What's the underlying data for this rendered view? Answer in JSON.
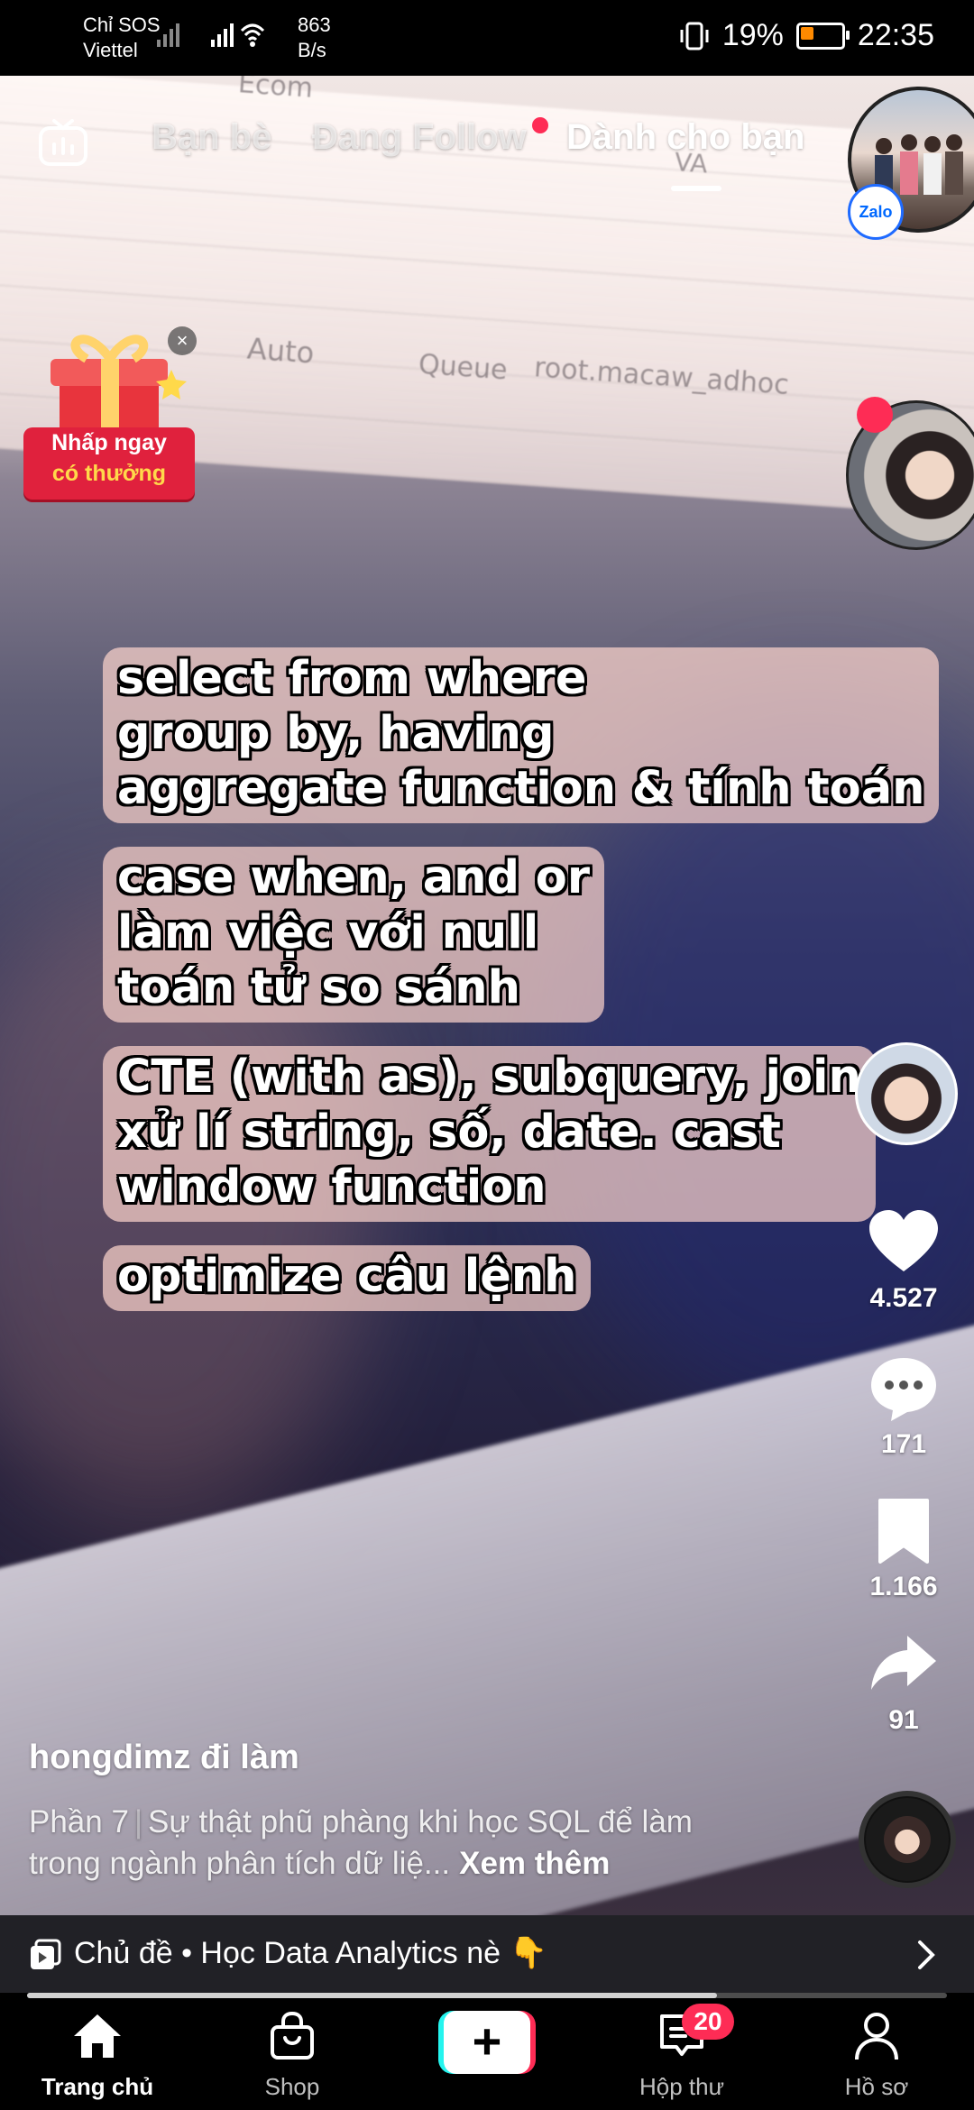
{
  "status_bar": {
    "carrier_line1": "Chỉ SOS",
    "carrier_line2": "Viettel",
    "net_speed_value": "863",
    "net_speed_unit": "B/s",
    "battery_percent": "19%",
    "time": "22:35"
  },
  "top_nav": {
    "tabs": [
      {
        "label": "Bạn bè",
        "active": false
      },
      {
        "label": "Đang Follow",
        "active": false,
        "has_dot": true
      },
      {
        "label": "Dành cho bạn",
        "active": true
      }
    ],
    "zalo_badge": "Zalo"
  },
  "promo": {
    "line1": "Nhấp ngay",
    "line2": "có thưởng",
    "close": "×"
  },
  "background_text": [
    "Ecom",
    "VA",
    "Auto",
    "Queue",
    "root.macaw_adhoc"
  ],
  "captions": [
    [
      "select from where",
      "group by, having",
      "aggregate function & tính toán"
    ],
    [
      "case when, and or",
      "làm việc với null",
      "toán tử so sánh"
    ],
    [
      "CTE (with as), subquery, join",
      "xử lí string, số, date. cast",
      "window function"
    ],
    [
      "optimize câu lệnh"
    ]
  ],
  "actions": {
    "likes": "4.527",
    "comments": "171",
    "saves": "1.166",
    "shares": "91"
  },
  "post": {
    "username": "hongdimz đi làm",
    "part": "Phần 7",
    "description": "Sự thật phũ phàng khi học SQL để làm trong ngành phân tích dữ liệ...",
    "see_more": "Xem thêm"
  },
  "topic": {
    "label": "Chủ đề • Học Data Analytics nè 👇"
  },
  "playback_progress": 0.75,
  "bottom_nav": {
    "home": "Trang chủ",
    "shop": "Shop",
    "inbox": "Hộp thư",
    "inbox_badge": "20",
    "profile": "Hồ sơ"
  },
  "colors": {
    "accent_red": "#fe2c55",
    "accent_cyan": "#25f4ee",
    "promo_red": "#e0213d",
    "zalo_blue": "#0068ff"
  }
}
